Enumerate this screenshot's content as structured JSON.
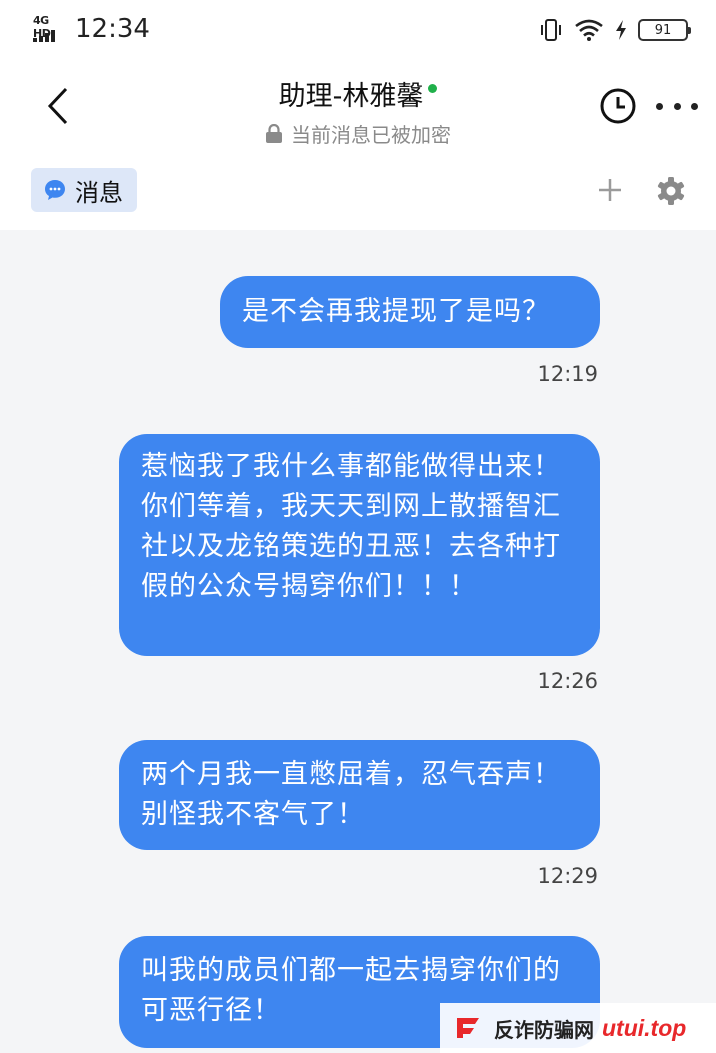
{
  "status_bar": {
    "network": "4G HD",
    "time": "12:34",
    "battery": "91",
    "icons": [
      "vibrate-icon",
      "wifi-icon",
      "charging-icon",
      "battery-icon"
    ]
  },
  "header": {
    "title": "助理-林雅馨",
    "subtitle": "当前消息已被加密",
    "icons": [
      "back-arrow-icon",
      "online-dot",
      "lock-icon",
      "clock-icon",
      "more-dots-icon"
    ],
    "colors": {
      "online": "#20b04a"
    }
  },
  "tabs": {
    "message_label": "消息",
    "icons": [
      "chat-bubble-icon",
      "plus-icon",
      "gear-icon"
    ],
    "colors": {
      "active_bg": "#dde7f8",
      "icon": "#3e86f0"
    }
  },
  "messages": [
    {
      "text": "是不会再我提现了是吗？",
      "time": "12:19"
    },
    {
      "text": "惹恼我了我什么事都能做得出来！你们等着，我天天到网上散播智汇社以及龙铭策选的丑恶！去各种打假的公众号揭穿你们！！！",
      "time": "12:26"
    },
    {
      "text": "两个月我一直憋屈着，忍气吞声！别怪我不客气了！",
      "time": "12:29"
    },
    {
      "text": "叫我的成员们都一起去揭穿你们的可恶行径！"
    }
  ],
  "bubble_color": "#3e86f0",
  "watermark": {
    "text": "反诈防骗网",
    "domain": "utui.top",
    "colors": {
      "domain": "#e8282b",
      "logo": "#e8282b"
    }
  }
}
